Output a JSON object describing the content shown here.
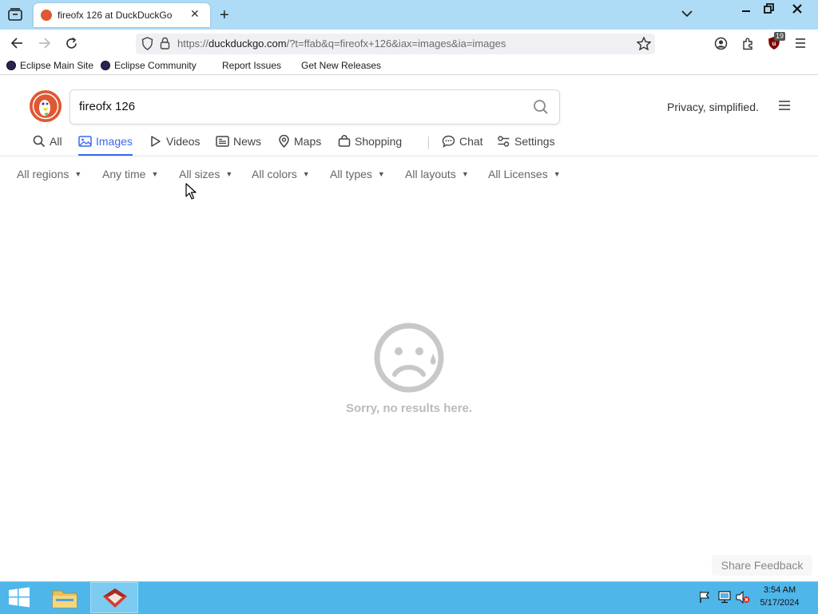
{
  "browser": {
    "tab_title": "fireofx 126 at DuckDuckGo",
    "url_prefix": "https://",
    "url_host": "duckduckgo.com",
    "url_rest": "/?t=ffab&q=fireofx+126&iax=images&ia=images",
    "extension_badge": "19",
    "bookmarks": [
      "Eclipse Main Site",
      "Eclipse Community",
      "Report Issues",
      "Get New Releases"
    ]
  },
  "ddg": {
    "search_query": "fireofx 126",
    "tagline": "Privacy, simplified.",
    "tabs": [
      {
        "label": "All"
      },
      {
        "label": "Images"
      },
      {
        "label": "Videos"
      },
      {
        "label": "News"
      },
      {
        "label": "Maps"
      },
      {
        "label": "Shopping"
      },
      {
        "label": "Chat"
      },
      {
        "label": "Settings"
      }
    ],
    "filters": [
      "All regions",
      "Any time",
      "All sizes",
      "All colors",
      "All types",
      "All layouts",
      "All Licenses"
    ],
    "empty_message": "Sorry, no results here.",
    "feedback_label": "Share Feedback"
  },
  "taskbar": {
    "time": "3:54 AM",
    "date": "5/17/2024"
  },
  "colors": {
    "accent": "#3969ef",
    "tabstrip": "#aedcf7",
    "taskbar": "#4fb6ea",
    "ddg_orange": "#de5833"
  }
}
